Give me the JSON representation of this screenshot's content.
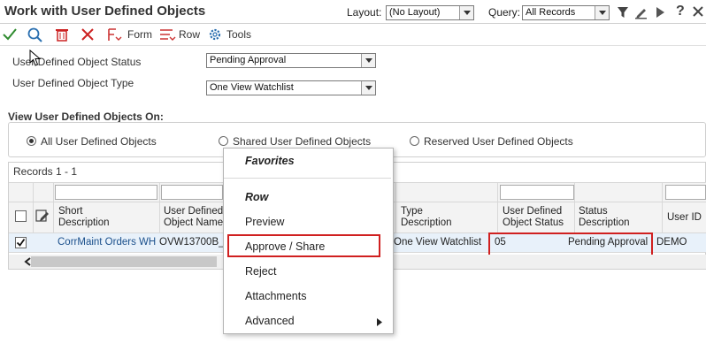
{
  "header": {
    "title": "Work with User Defined Objects",
    "layout_label": "Layout:",
    "layout_value": "(No Layout)",
    "query_label": "Query:",
    "query_value": "All Records"
  },
  "toolbar": {
    "form_label": "Form",
    "row_label": "Row",
    "tools_label": "Tools"
  },
  "filters": {
    "status_label": "User Defined Object Status",
    "status_value": "Pending Approval",
    "type_label": "User Defined Object Type",
    "type_value": "One View Watchlist"
  },
  "view_on": {
    "heading": "View User Defined Objects On:",
    "options": [
      "All User Defined Objects",
      "Shared User Defined Objects",
      "Reserved User Defined Objects"
    ],
    "selected": "All User Defined Objects"
  },
  "grid": {
    "records": "Records 1 - 1",
    "columns": [
      {
        "line1": "Short",
        "line2": "Description"
      },
      {
        "line1": "User Defined",
        "line2": "Object Name"
      },
      {
        "line1": "Type",
        "line2": "Description"
      },
      {
        "line1": "User Defined",
        "line2": "Object Status"
      },
      {
        "line1": "Status",
        "line2": "Description"
      },
      {
        "line1": "User ID",
        "line2": ""
      }
    ],
    "row": {
      "short_description": "CorrMaint Orders WH",
      "object_name": "OVW13700B_2",
      "type_description": "One View Watchlist",
      "object_status": "05",
      "status_description": "Pending Approval",
      "user_id": "DEMO"
    }
  },
  "context_menu": {
    "favorites": "Favorites",
    "row_heading": "Row",
    "items": [
      "Preview",
      "Approve / Share",
      "Reject",
      "Attachments",
      "Advanced"
    ]
  },
  "colors": {
    "highlight": "#d02020",
    "link": "#1a4f8b",
    "ok_check": "#2e8b2e",
    "cancel_x": "#cc2222",
    "search": "#2a6fb0"
  }
}
